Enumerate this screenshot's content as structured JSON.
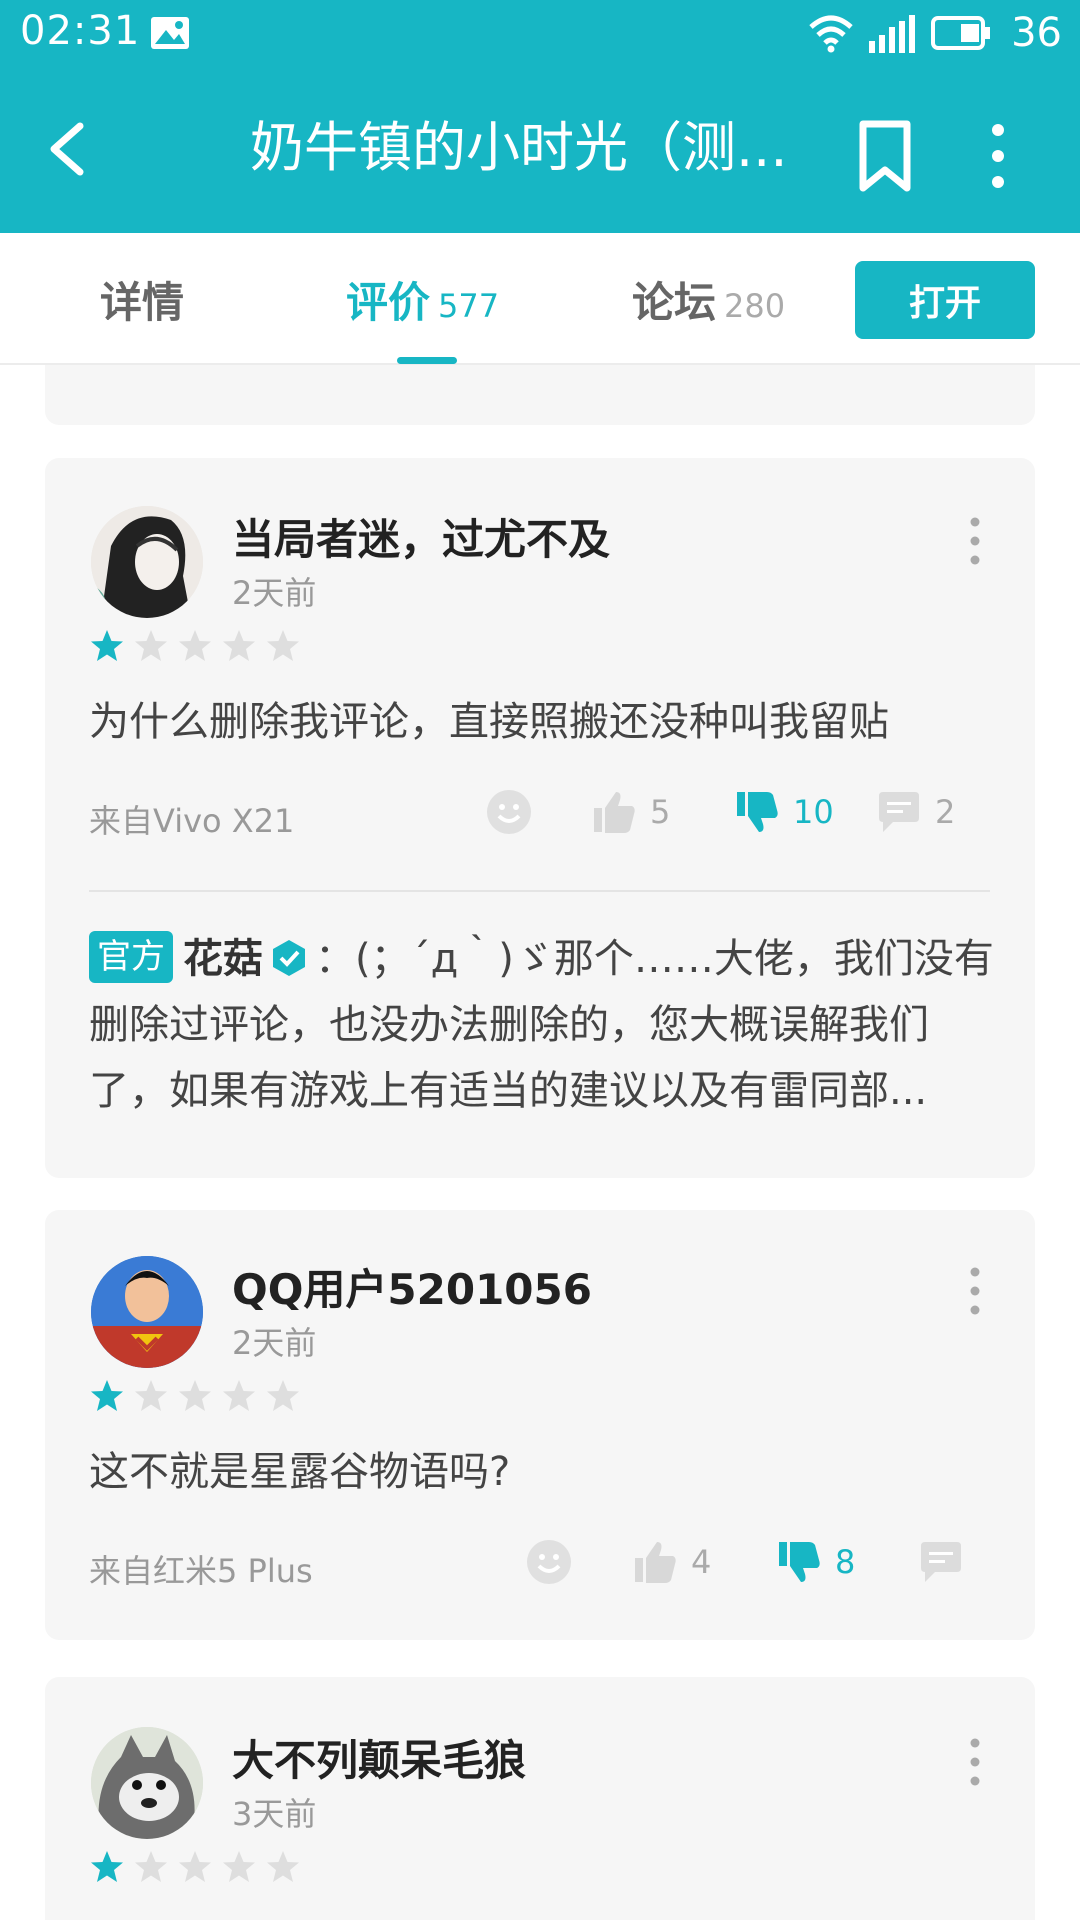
{
  "status_bar": {
    "time": "02:31",
    "battery": "36",
    "network": "4G"
  },
  "app_bar": {
    "title": "奶牛镇的小时光（测..."
  },
  "tabs": [
    {
      "label": "详情",
      "count": ""
    },
    {
      "label": "评价",
      "count": "577"
    },
    {
      "label": "论坛",
      "count": "280"
    }
  ],
  "open_button": "打开",
  "colors": {
    "accent": "#17b6c4"
  },
  "reviews": [
    {
      "username": "当局者迷，过尤不及",
      "time": "2天前",
      "rating": 1,
      "content": "为什么删除我评论，直接照搬还没种叫我留贴",
      "source": "来自Vivo X21",
      "likes": "5",
      "dislikes": "10",
      "comments": "2",
      "reply": {
        "badge": "官方",
        "name": "花菇",
        "text": "：(；´д｀)ゞ那个……大佬，我们没有删除过评论，也没办法删除的，您大概误解我们了，如果有游戏上有适当的建议以及有雷同部..."
      }
    },
    {
      "username": "QQ用户5201056",
      "time": "2天前",
      "rating": 1,
      "content": "这不就是星露谷物语吗?",
      "source": "来自红米5 Plus",
      "likes": "4",
      "dislikes": "8",
      "comments": ""
    },
    {
      "username": "大不列颠呆毛狼",
      "time": "3天前",
      "rating": 1
    }
  ]
}
